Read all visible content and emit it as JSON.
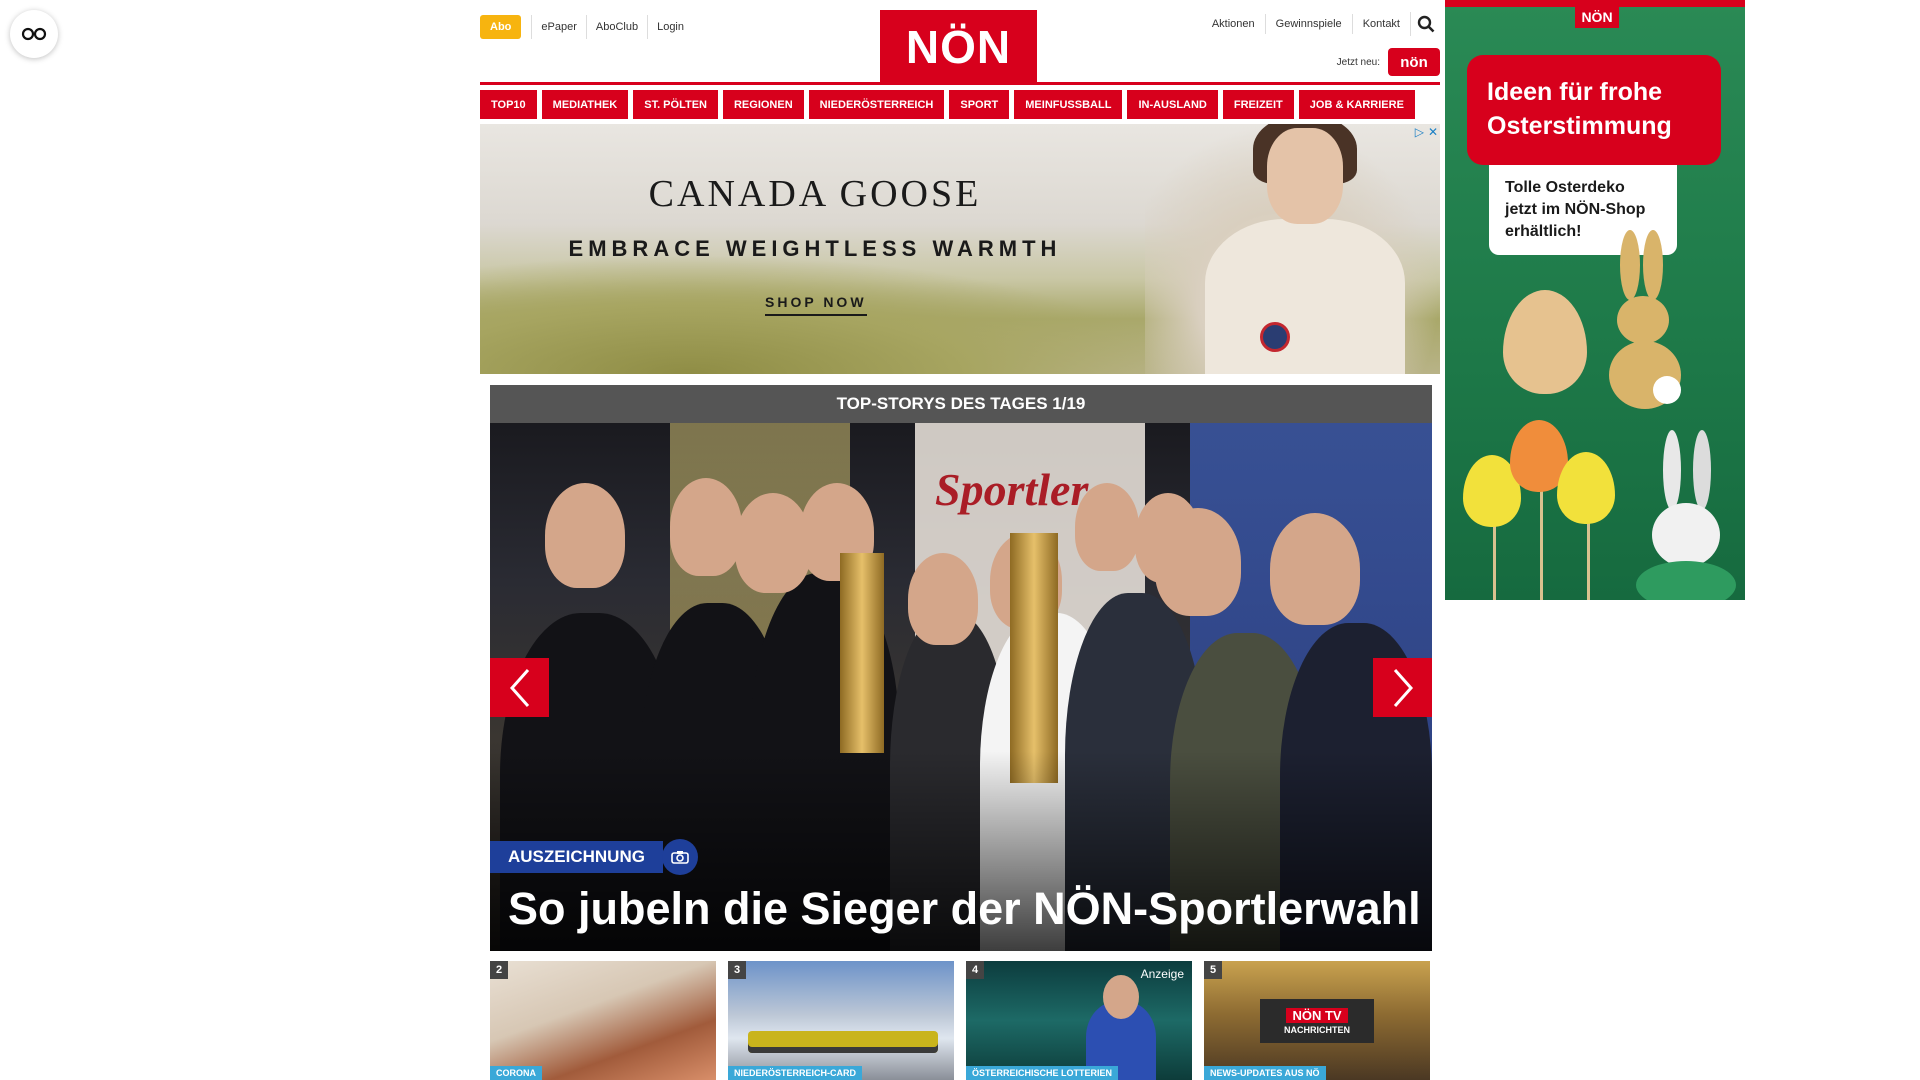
{
  "header": {
    "abo_label": "Abo",
    "epaper_label": "ePaper",
    "aboclub_label": "AboClub",
    "login_label": "Login",
    "logo_text": "NÖN",
    "aktionen_label": "Aktionen",
    "gewinnspiele_label": "Gewinnspiele",
    "kontakt_label": "Kontakt",
    "jetzt_neu_label": "Jetzt neu:",
    "kinder_badge_text": "nön",
    "search_icon": "search-icon"
  },
  "mainnav": {
    "items": [
      "TOP10",
      "MEDIATHEK",
      "ST. PÖLTEN",
      "REGIONEN",
      "NIEDERÖSTERREICH",
      "SPORT",
      "MEINFUSSBALL",
      "IN-AUSLAND",
      "FREIZEIT",
      "JOB & KARRIERE"
    ]
  },
  "ad_banner": {
    "brand": "CANADA GOOSE",
    "tagline": "EMBRACE WEIGHTLESS WARMTH",
    "cta": "SHOP NOW"
  },
  "side_ad": {
    "logo_text": "NÖN",
    "headline": "Ideen für frohe Osterstimmung",
    "note": "Tolle Osterdeko jetzt im NÖN-Shop erhältlich!"
  },
  "stories": {
    "header": "TOP-STORYS DES TAGES 1/19",
    "category": "AUSZEICHNUNG",
    "title": "So jubeln die Sieger der NÖN-Sportlerwahl",
    "backdrop_text": "Sportler"
  },
  "thumbs": [
    {
      "num": "2",
      "cat": "CORONA",
      "anzeige": ""
    },
    {
      "num": "3",
      "cat": "NIEDERÖSTERREICH-CARD",
      "anzeige": ""
    },
    {
      "num": "4",
      "cat": "ÖSTERREICHISCHE LOTTERIEN",
      "anzeige": "Anzeige"
    },
    {
      "num": "5",
      "cat": "NEWS-UPDATES AUS NÖ",
      "anzeige": "",
      "tv_top": "NÖN TV",
      "tv_bottom": "NACHRICHTEN"
    }
  ],
  "colors": {
    "brand_red": "#d7001c",
    "abo_yellow": "#f7b40f",
    "badge_blue": "#1e3f9a",
    "thumb_cat_blue": "#3aa8d8"
  }
}
